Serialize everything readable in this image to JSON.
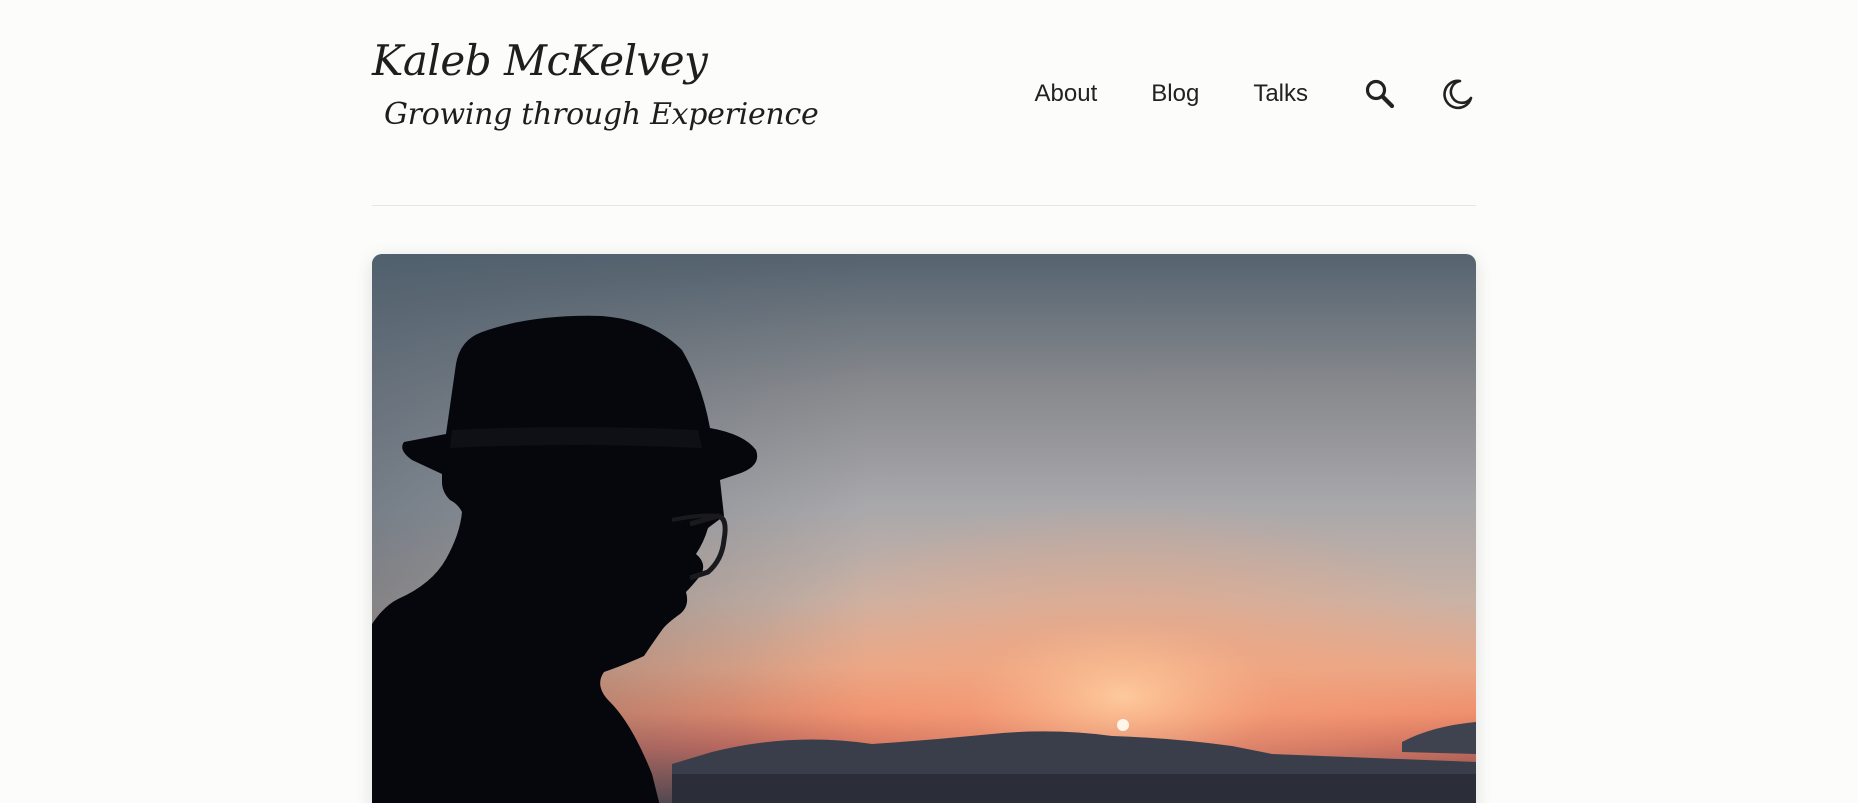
{
  "header": {
    "site_title": "Kaleb McKelvey",
    "site_subtitle": "Growing through Experience"
  },
  "nav": {
    "items": [
      {
        "label": "About"
      },
      {
        "label": "Blog"
      },
      {
        "label": "Talks"
      }
    ],
    "search_icon": "search-icon",
    "theme_toggle_icon": "moon-icon"
  },
  "hero": {
    "image_alt": "Silhouette of a man wearing a fedora and glasses against a sunset over the sea",
    "icon": "hero-image"
  },
  "colors": {
    "background": "#fcfcfa",
    "text": "#1e1e1e",
    "divider": "#e6e6e6",
    "sunset_orange": "#f2a07a",
    "sky_top": "#55636f"
  }
}
